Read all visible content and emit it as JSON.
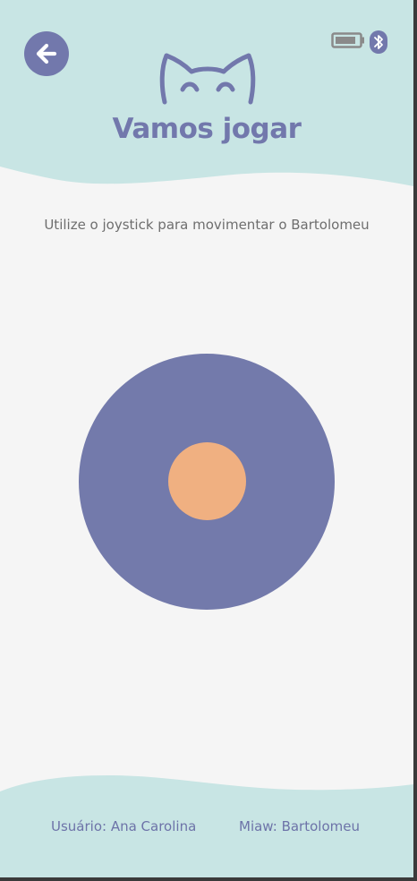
{
  "header": {
    "title": "Vamos jogar",
    "back_icon": "arrow-left-icon",
    "battery_icon": "battery-icon",
    "bluetooth_icon": "bluetooth-icon",
    "logo_icon": "cat-face-icon"
  },
  "main": {
    "instruction": "Utilize o joystick para movimentar o Bartolomeu"
  },
  "footer": {
    "user": "Usuário: Ana Carolina",
    "pet": "Miaw: Bartolomeu"
  },
  "colors": {
    "header_bg": "#c8e5e4",
    "accent": "#7278ac",
    "joystick_base": "#737aab",
    "joystick_knob": "#f0b081",
    "page_bg": "#f5f5f5"
  }
}
